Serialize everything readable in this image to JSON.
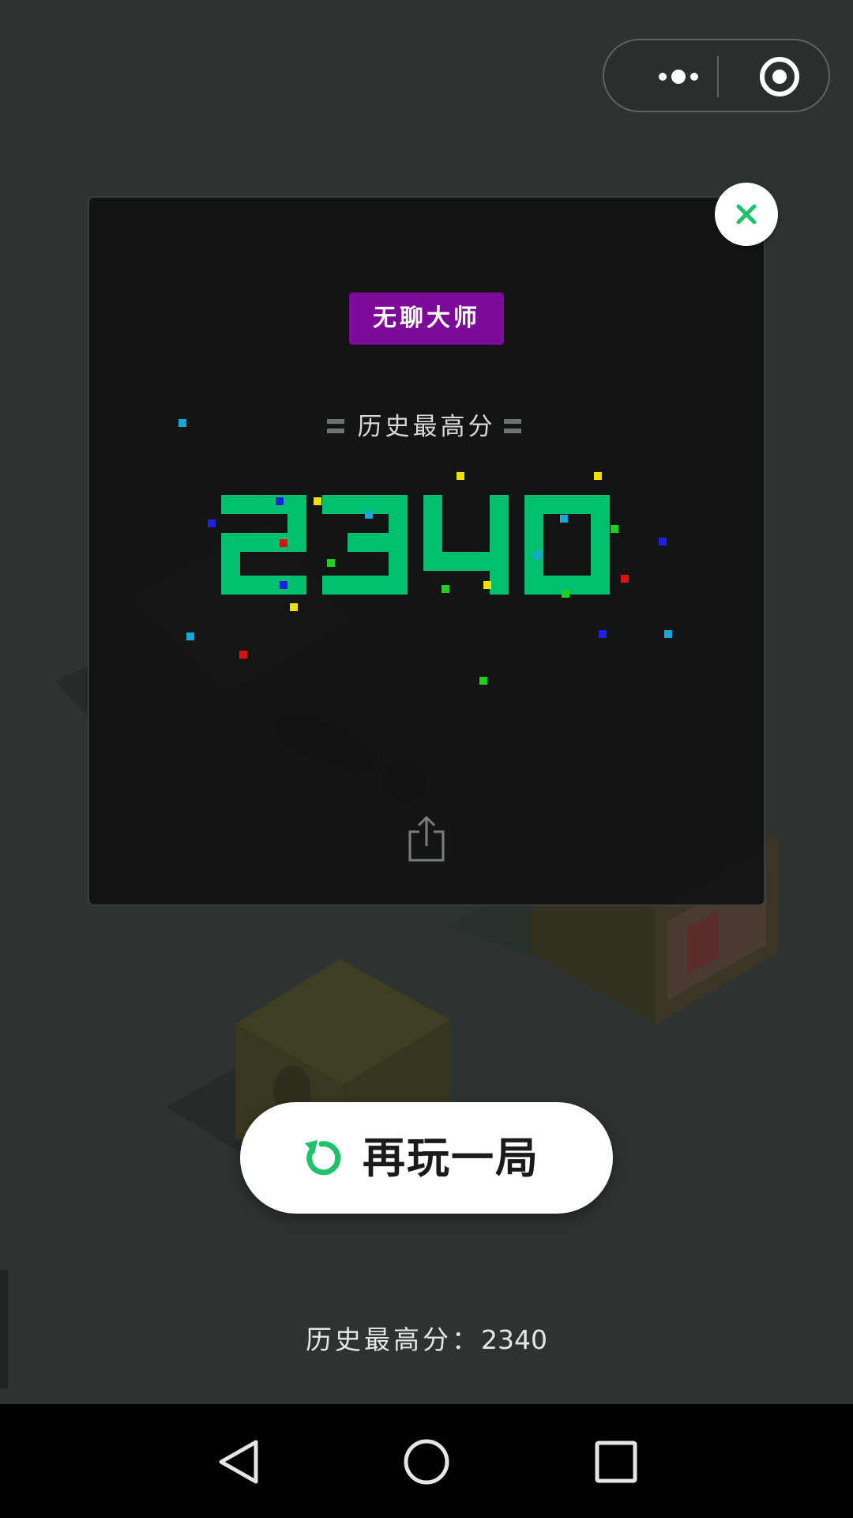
{
  "capsule": {
    "more_icon": "more-dots-icon",
    "target_icon": "target-icon"
  },
  "modal": {
    "badge": "无聊大师",
    "high_score_title": "历史最高分",
    "big_score": "2340",
    "score_color": "#00c070",
    "share_icon": "share-icon",
    "close_icon": "close-icon"
  },
  "replay": {
    "label": "再玩一局",
    "icon": "replay-icon",
    "accent": "#1ec26b"
  },
  "footer": {
    "label": "历史最高分：",
    "score": "2340"
  },
  "navbar": {
    "back_icon": "back-triangle-icon",
    "home_icon": "home-circle-icon",
    "recent_icon": "recent-square-icon"
  }
}
